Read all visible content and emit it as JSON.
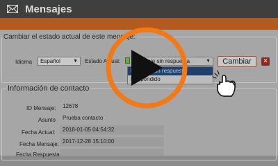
{
  "window": {
    "title": "Mensajes"
  },
  "state_section": {
    "legend": "Cambiar el estado actual de este mensaje:",
    "language_label": "Idioma",
    "language_value": "Español",
    "status_label": "Estado Actual:",
    "status_value": "Mensaje sin respuesta",
    "status_options": [
      "Mensaje sin respuesta",
      "Respondido"
    ],
    "change_button": "Cambiar",
    "close_label": "×"
  },
  "contact_section": {
    "legend": "Información de contacto",
    "fields": [
      {
        "label": "ID Mensaje:",
        "value": "12678"
      },
      {
        "label": "Asunto",
        "value": "Prueba contacto"
      },
      {
        "label": "Fecha Actual:",
        "value": "2018-01-05 04:54:32"
      },
      {
        "label": "Fecha Mensaje:",
        "value": "2017-12-28 15:10:00"
      },
      {
        "label": "Fecha Respuesta",
        "value": ""
      }
    ]
  },
  "overlay": {
    "icon": "play-icon",
    "accent": "#f07a1a"
  },
  "colors": {
    "titlebar": "#3f3f3f",
    "accent_bar": "#b35a1f",
    "selected_option": "#20406e"
  }
}
